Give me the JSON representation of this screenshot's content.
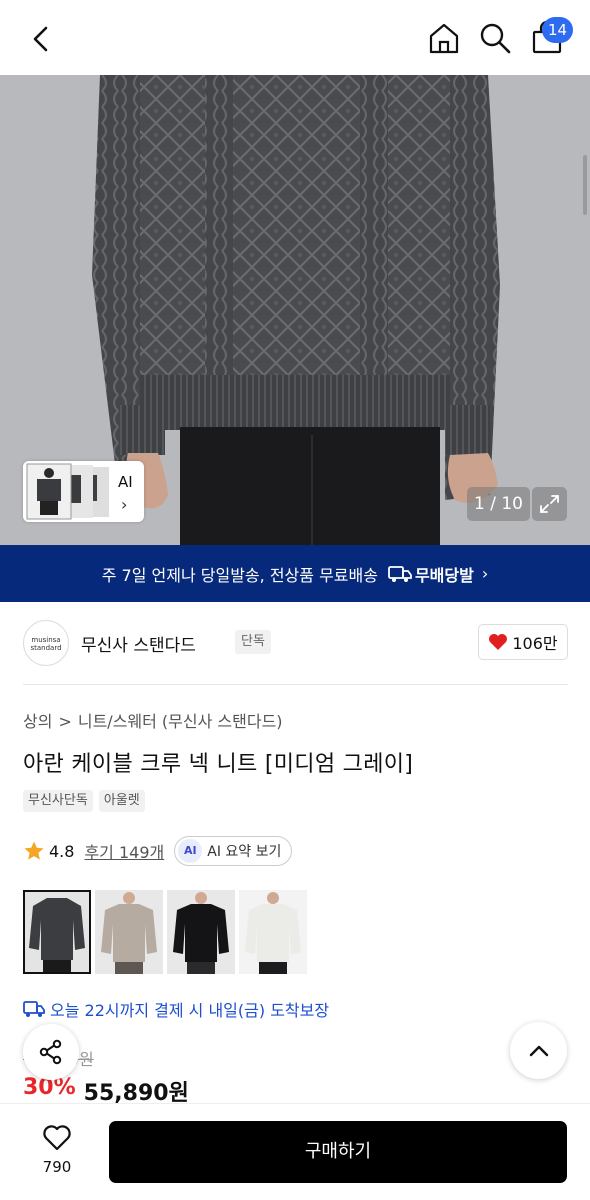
{
  "header": {
    "cart_count": "14",
    "icons": [
      "chevron-left-icon",
      "home-icon",
      "search-icon",
      "shopping-bag-icon"
    ]
  },
  "gallery": {
    "ai_label": "AI",
    "counter": "1 / 10"
  },
  "banner": {
    "text": "주 7일 언제나 당일발송, 전상품 무료배송",
    "badge": "무배당발",
    "arrow": "›"
  },
  "brand": {
    "logo_text": "musinsa standard",
    "name": "무신사 스탠다드",
    "tag": "단독",
    "likes": "106만"
  },
  "product": {
    "breadcrumb": [
      "상의",
      "니트/스웨터 (무신사 스탠다드)"
    ],
    "breadcrumb_sep": ">",
    "title": "아란 케이블 크루 넥 니트 [미디엄 그레이]",
    "tags": [
      "무신사단독",
      "아울렛"
    ],
    "rating": "4.8",
    "reviews": "후기 149개",
    "ai_badge": "AI",
    "ai_summary": "AI 요약 보기",
    "swatch_colors": [
      "#3b3d40",
      "#b5aba1",
      "#141416",
      "#ebebe7"
    ],
    "delivery": "오늘 22시까지 결제 시 내일(금) 도착보장",
    "original_price": "79,890원",
    "discount": "30%",
    "price": "55,890원"
  },
  "bottom": {
    "wish_count": "790",
    "buy_label": "구매하기"
  },
  "colors": {
    "accent_blue": "#2d6cf0",
    "banner_navy": "#06297c",
    "discount_red": "#e8272b",
    "like_red": "#e02020"
  }
}
